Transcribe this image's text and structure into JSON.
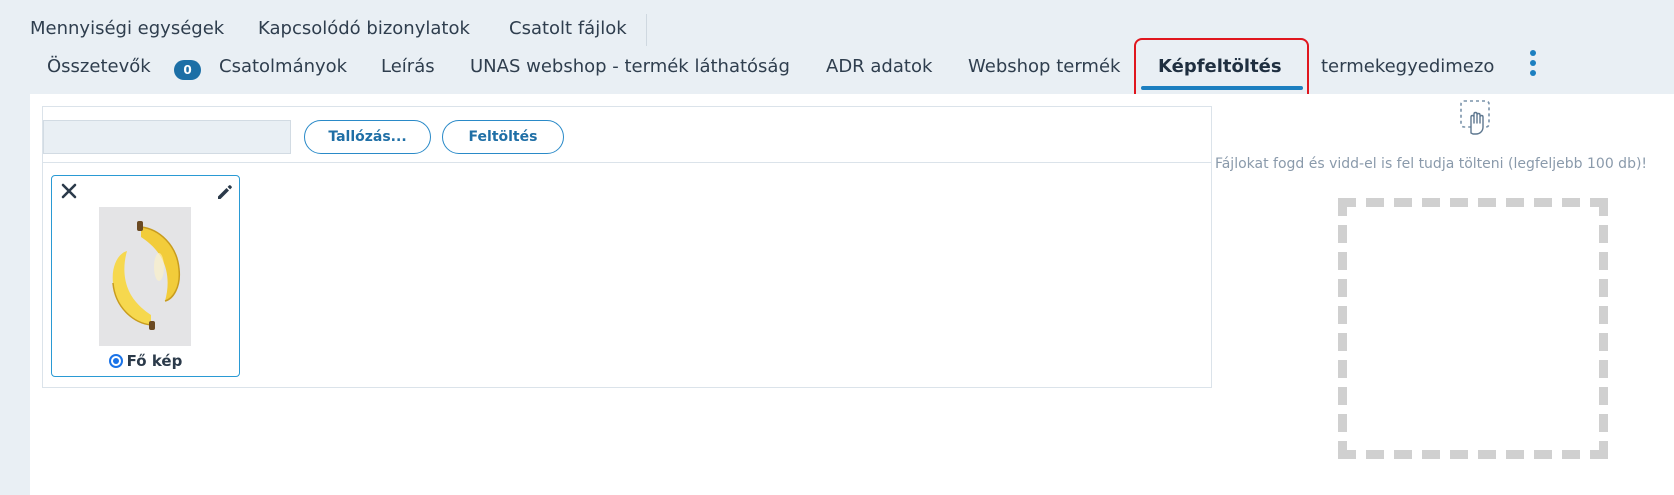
{
  "top_tabs": [
    {
      "label": "Mennyiségi egységek"
    },
    {
      "label": "Kapcsolódó bizonylatok"
    },
    {
      "label": "Csatolt fájlok"
    }
  ],
  "tabs": [
    {
      "label": "Összetevők",
      "badge": "0"
    },
    {
      "label": "Csatolmányok"
    },
    {
      "label": "Leírás"
    },
    {
      "label": "UNAS webshop - termék láthatóság"
    },
    {
      "label": "ADR adatok"
    },
    {
      "label": "Webshop termék"
    },
    {
      "label": "Képfeltöltés",
      "active": true
    },
    {
      "label": "termekegyedimezo"
    }
  ],
  "uploader": {
    "file_input_value": "",
    "browse_label": "Tallózás...",
    "upload_label": "Feltöltés"
  },
  "image_card": {
    "main_image_label": "Fő kép",
    "main_image_selected": true
  },
  "drop": {
    "hint": "Fájlokat fogd és vidd-el is fel tudja tölteni (legfeljebb 100 db)!"
  },
  "colors": {
    "accent": "#1c7fc0",
    "highlight_border": "#e0161e",
    "background": "#e9eff4"
  }
}
